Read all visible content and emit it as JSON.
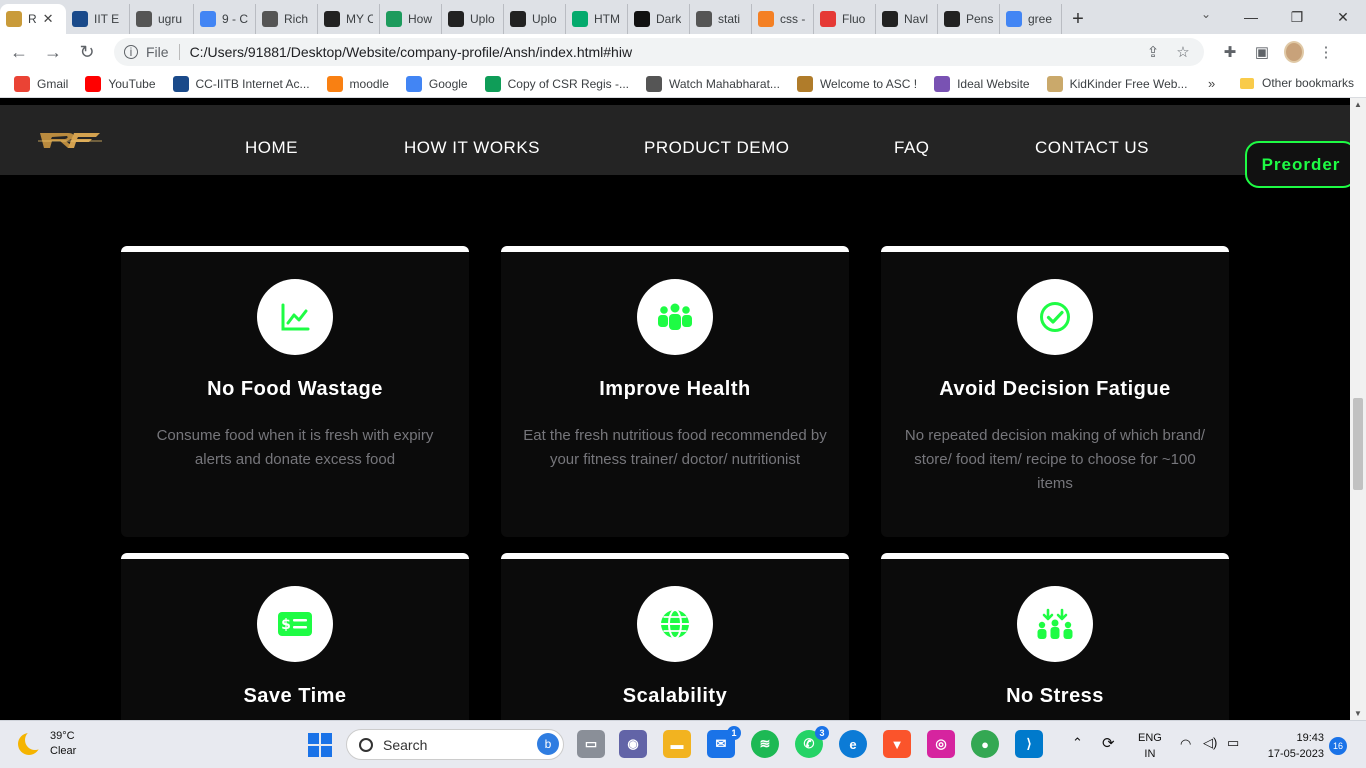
{
  "browser": {
    "tabs": [
      {
        "label": "R",
        "icon": "rf-icon",
        "color": "#c99b3a"
      },
      {
        "label": "IIT E",
        "icon": "iitb-icon",
        "color": "#1a4a8a"
      },
      {
        "label": "ugru",
        "icon": "globe-icon",
        "color": "#555555"
      },
      {
        "label": "9 - C",
        "icon": "google-icon",
        "color": "#4285f4"
      },
      {
        "label": "Rich",
        "icon": "globe-icon",
        "color": "#555555"
      },
      {
        "label": "MY C",
        "icon": "codepen-icon",
        "color": "#222222"
      },
      {
        "label": "How",
        "icon": "goodnotes-icon",
        "color": "#1d9b5d"
      },
      {
        "label": "Uplo",
        "icon": "cloud-icon",
        "color": "#222222"
      },
      {
        "label": "Uplo",
        "icon": "cloud-icon",
        "color": "#222222"
      },
      {
        "label": "HTM",
        "icon": "w3schools-icon",
        "color": "#04aa6d"
      },
      {
        "label": "Dark",
        "icon": "github-icon",
        "color": "#111111"
      },
      {
        "label": "stati",
        "icon": "globe-icon",
        "color": "#555555"
      },
      {
        "label": "css -",
        "icon": "stackoverflow-icon",
        "color": "#f48024"
      },
      {
        "label": "Fluo",
        "icon": "record-icon",
        "color": "#e53935"
      },
      {
        "label": "Navl",
        "icon": "codepen-icon",
        "color": "#222222"
      },
      {
        "label": "Pens",
        "icon": "codepen-icon",
        "color": "#222222"
      },
      {
        "label": "gree",
        "icon": "google-icon",
        "color": "#4285f4"
      }
    ],
    "address": {
      "scheme": "File",
      "url": "C:/Users/91881/Desktop/Website/company-profile/Ansh/index.html#hiw"
    },
    "bookmarks": [
      {
        "label": "Gmail",
        "icon": "gmail-icon",
        "color": "#ea4335"
      },
      {
        "label": "YouTube",
        "icon": "youtube-icon",
        "color": "#ff0000"
      },
      {
        "label": "CC-IITB Internet Ac...",
        "icon": "iitb-icon",
        "color": "#1a4a8a"
      },
      {
        "label": "moodle",
        "icon": "moodle-icon",
        "color": "#f98012"
      },
      {
        "label": "Google",
        "icon": "google-icon",
        "color": "#4285f4"
      },
      {
        "label": "Copy of CSR Regis -...",
        "icon": "sheets-icon",
        "color": "#0f9d58"
      },
      {
        "label": "Watch Mahabharat...",
        "icon": "globe-icon",
        "color": "#555555"
      },
      {
        "label": "Welcome to ASC !",
        "icon": "asc-icon",
        "color": "#b07c2a"
      },
      {
        "label": "Ideal Website",
        "icon": "bootstrap-icon",
        "color": "#7952b3"
      },
      {
        "label": "KidKinder Free Web...",
        "icon": "kidkinder-icon",
        "color": "#caa96b"
      }
    ],
    "more": "»",
    "other_bookmarks": "Other bookmarks"
  },
  "site": {
    "nav": [
      "HOME",
      "HOW IT WORKS",
      "PRODUCT DEMO",
      "FAQ",
      "CONTACT US"
    ],
    "preorder": "Preorder",
    "accent": "#1efc44",
    "features": [
      {
        "title": "No Food Wastage",
        "text": "Consume food when it is fresh with expiry alerts and donate excess food",
        "icon": "chart-line-icon"
      },
      {
        "title": "Improve Health",
        "text": "Eat the fresh nutritious food recommended by your fitness trainer/ doctor/ nutritionist",
        "icon": "people-group-icon"
      },
      {
        "title": "Avoid Decision Fatigue",
        "text": "No repeated decision making of which brand/ store/ food item/ recipe to choose for ~100 items",
        "icon": "check-circle-icon"
      },
      {
        "title": "Save Time",
        "text": "",
        "icon": "money-bill-icon"
      },
      {
        "title": "Scalability",
        "text": "",
        "icon": "globe-icon"
      },
      {
        "title": "No Stress",
        "text": "",
        "icon": "people-arrows-icon"
      }
    ]
  },
  "taskbar": {
    "weather": {
      "temp": "39°C",
      "condition": "Clear"
    },
    "search_placeholder": "Search",
    "mail_badge": "1",
    "whatsapp_badge": "3",
    "lang": "ENG",
    "region": "IN",
    "time": "19:43",
    "date": "17-05-2023",
    "notifications": "16"
  }
}
